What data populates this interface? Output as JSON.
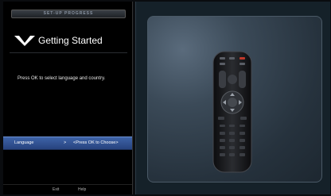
{
  "setup": {
    "progress_label": "SET-UP PROGRESS",
    "logo_icon": "vizio-v-logo-icon",
    "title": "Getting Started",
    "instruction": "Press OK to select language and country.",
    "language_row": {
      "label": "Language",
      "arrow": ">",
      "value": "<Press OK to Choose>"
    },
    "footer": {
      "exit_label": "Exit",
      "help_label": "Help"
    }
  },
  "display": {
    "image": "remote-control-image"
  },
  "colors": {
    "highlight": "#3e63a8",
    "panel_bg": "#000000",
    "display_bg": "#152129"
  }
}
